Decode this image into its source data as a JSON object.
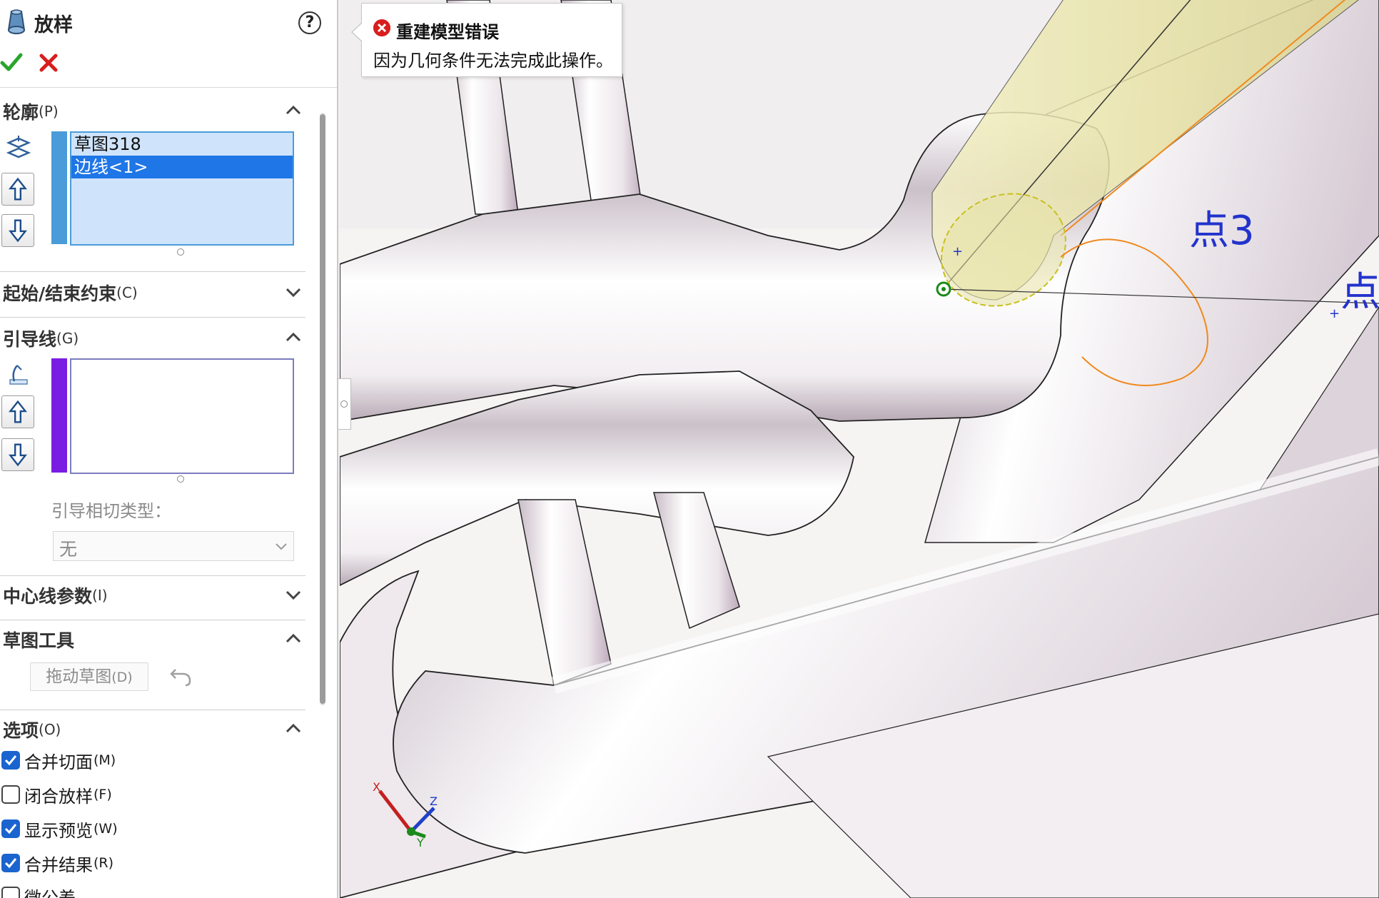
{
  "panel": {
    "title": "放样",
    "help": "?",
    "sections": {
      "profiles": {
        "title": "轮廓",
        "key": "(P)"
      },
      "start_end": {
        "title": "起始/结束约束",
        "key": "(C)"
      },
      "guides": {
        "title": "引导线",
        "key": "(G)"
      },
      "centerline": {
        "title": "中心线参数",
        "key": "(I)"
      },
      "sketch_tools": {
        "title": "草图工具"
      },
      "options": {
        "title": "选项",
        "key": "(O)"
      }
    },
    "profile_items": [
      "草图318",
      "边线<1>"
    ],
    "guide_tangency_label": "引导相切类型：",
    "guide_tangency_value": "无",
    "drag_sketch_label": "拖动草图",
    "drag_sketch_key": "(D)",
    "options": [
      {
        "label": "合并切面",
        "key": "(M)",
        "checked": true
      },
      {
        "label": "闭合放样",
        "key": "(F)",
        "checked": false
      },
      {
        "label": "显示预览",
        "key": "(W)",
        "checked": true
      },
      {
        "label": "合并结果",
        "key": "(R)",
        "checked": true
      },
      {
        "label": "微公差",
        "key": "",
        "checked": false
      }
    ]
  },
  "error_tooltip": {
    "title": "重建模型错误",
    "message": "因为几何条件无法完成此操作。"
  },
  "viewport": {
    "point_labels": [
      "点3",
      "点"
    ],
    "triad": {
      "x": "X",
      "y": "Y",
      "z": "Z"
    }
  },
  "colors": {
    "profile_bar": "#4a9bd9",
    "guide_bar": "#7a1de3",
    "selection": "#1f76e6",
    "point_label": "#2233cc",
    "preview_fill": "#e6e2a6",
    "orange_edge": "#f08a1e",
    "error_red": "#d81e1e",
    "ok_green": "#2aa52a",
    "cancel_red": "#d81e1e"
  }
}
